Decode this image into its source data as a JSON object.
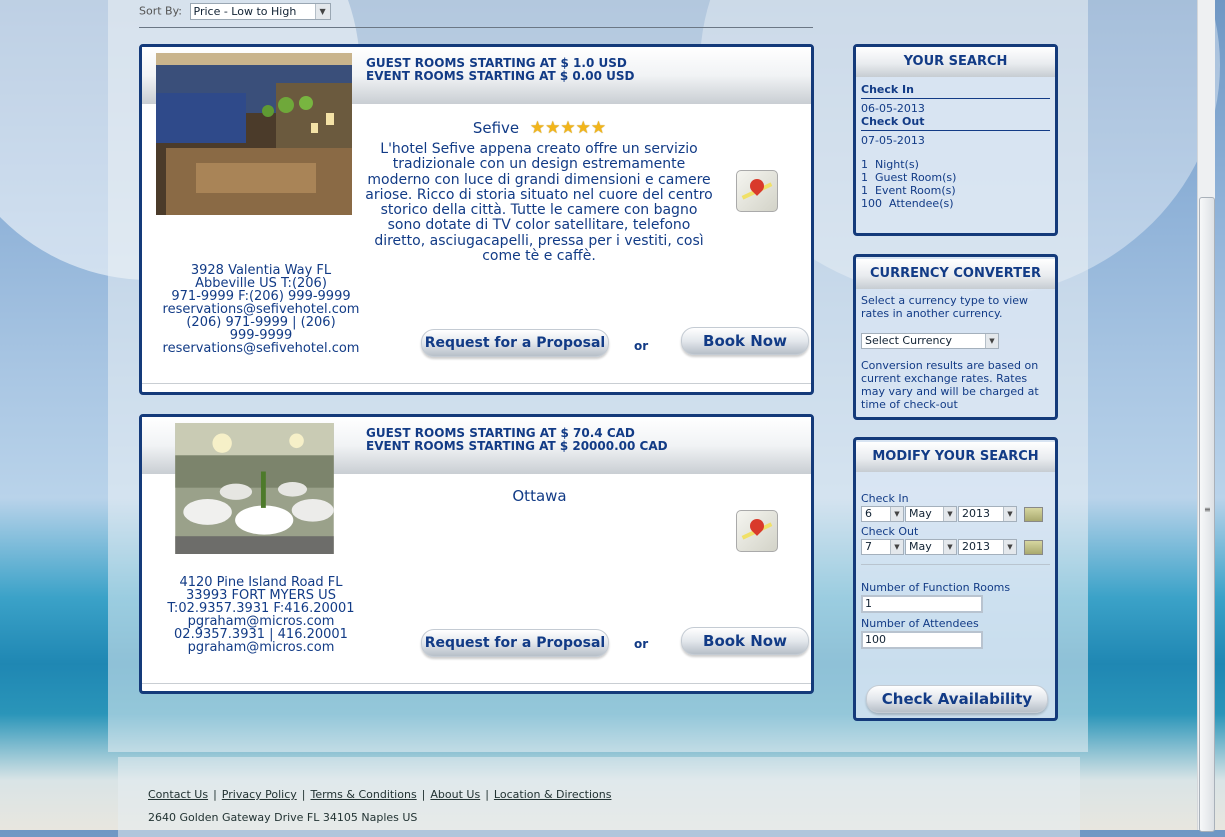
{
  "sort": {
    "label": "Sort By:",
    "selected": "Price - Low to High"
  },
  "hotels": [
    {
      "guest_rate": "GUEST ROOMS STARTING AT $ 1.0 USD",
      "event_rate": "EVENT ROOMS STARTING AT $ 0.00 USD",
      "name": "Sefive",
      "stars": 5,
      "description": "L'hotel Sefive appena creato offre un servizio tradizionale con un design estremamente moderno con luce di grandi dimensioni e camere ariose. Ricco di storia situato nel cuore del centro storico della città. Tutte le camere con bagno sono dotate di TV color satellitare, telefono diretto, asciugacapelli, pressa per i vestiti, così come tè e caffè.",
      "address_lines": [
        "3928 Valentia Way FL",
        "Abbeville US T:(206)",
        "971-9999 F:(206) 999-9999",
        "reservations@sefivehotel.com",
        "(206) 971-9999 | (206)",
        "999-9999",
        "reservations@sefivehotel.com"
      ],
      "rfp_label": "Request for a Proposal",
      "or_label": "or",
      "book_label": "Book Now"
    },
    {
      "guest_rate": "GUEST ROOMS STARTING AT $ 70.4 CAD",
      "event_rate": "EVENT ROOMS STARTING AT $ 20000.00 CAD",
      "name": "Ottawa",
      "description": "",
      "address_lines": [
        "4120 Pine Island Road FL",
        "33993 FORT MYERS US",
        "T:02.9357.3931 F:416.20001",
        "pgraham@micros.com",
        "02.9357.3931 | 416.20001",
        "pgraham@micros.com"
      ],
      "rfp_label": "Request for a Proposal",
      "or_label": "or",
      "book_label": "Book Now"
    }
  ],
  "your_search": {
    "title": "YOUR SEARCH",
    "check_in_label": "Check In",
    "check_in": "06-05-2013",
    "check_out_label": "Check Out",
    "check_out": "07-05-2013",
    "summary": [
      "1  Night(s)",
      "1  Guest Room(s)",
      "1  Event Room(s)",
      "100  Attendee(s)"
    ]
  },
  "currency": {
    "title": "CURRENCY CONVERTER",
    "intro": "Select a currency type to view rates in another currency.",
    "select": "Select Currency",
    "note": "Conversion results are based on current exchange rates. Rates may vary and will be charged at time of check-out"
  },
  "modify": {
    "title": "MODIFY YOUR SEARCH",
    "check_in_label": "Check In",
    "check_in": {
      "day": "6",
      "month": "May",
      "year": "2013"
    },
    "check_out_label": "Check Out",
    "check_out": {
      "day": "7",
      "month": "May",
      "year": "2013"
    },
    "function_rooms_label": "Number of Function Rooms",
    "function_rooms": "1",
    "attendees_label": "Number of Attendees",
    "attendees": "100",
    "submit_label": "Check Availability"
  },
  "footer": {
    "links": [
      "Contact Us",
      "Privacy Policy",
      "Terms & Conditions",
      "About Us",
      "Location & Directions"
    ],
    "address": "2640 Golden Gateway Drive FL 34105 Naples US"
  }
}
